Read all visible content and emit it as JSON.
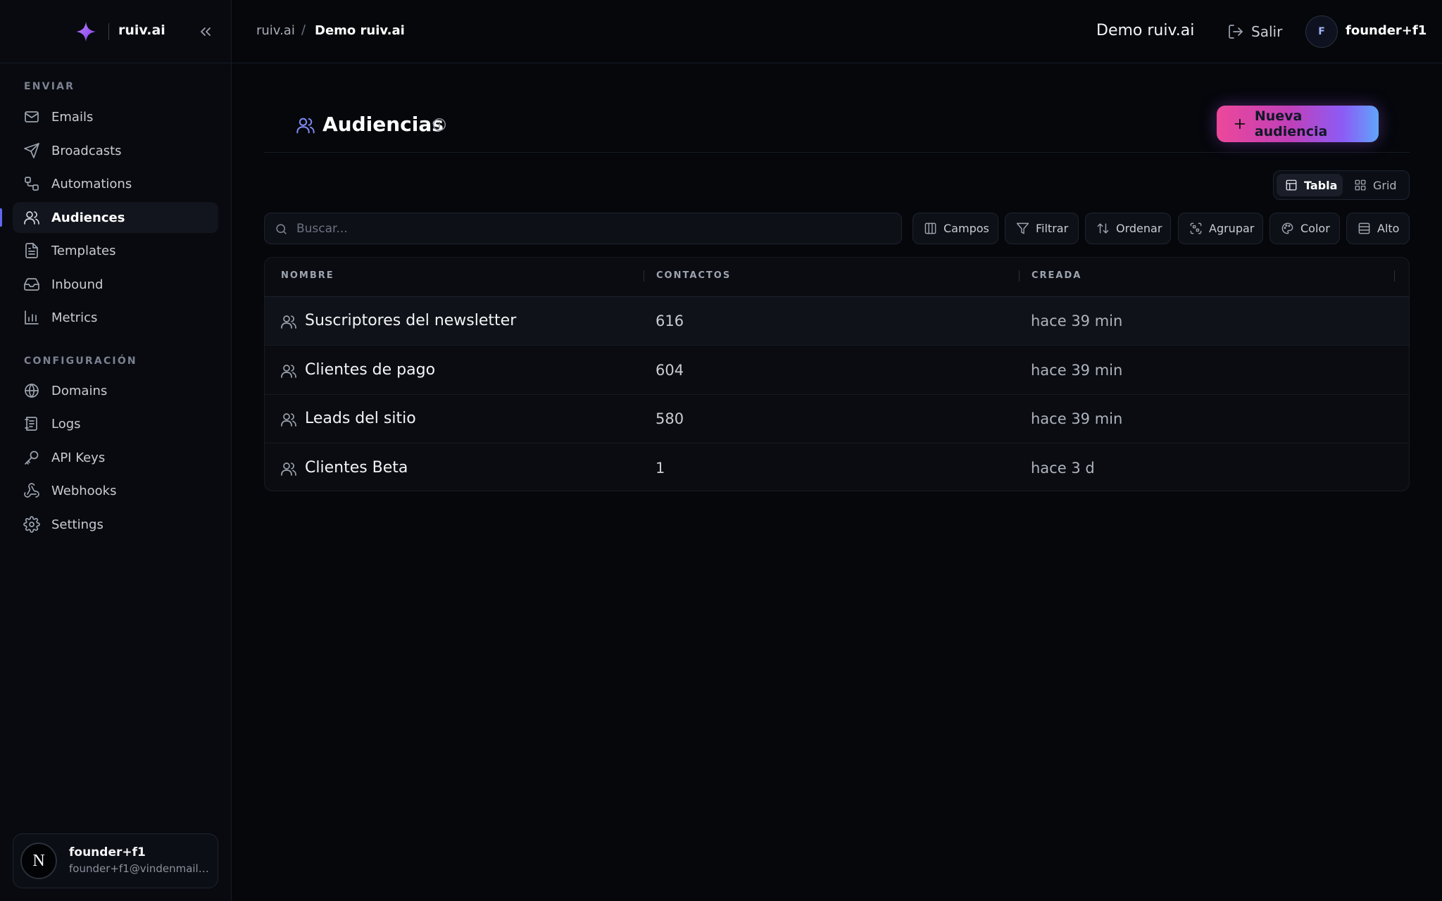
{
  "app": {
    "name": "ruiv.ai"
  },
  "sidebar": {
    "sections": [
      {
        "title": "ENVIAR"
      },
      {
        "title": "CONFIGURACIÓN"
      }
    ],
    "items": [
      {
        "label": "Emails",
        "icon": "mail-icon"
      },
      {
        "label": "Broadcasts",
        "icon": "send-icon"
      },
      {
        "label": "Automations",
        "icon": "workflow-icon"
      },
      {
        "label": "Audiences",
        "icon": "users-icon",
        "active": true
      },
      {
        "label": "Templates",
        "icon": "file-text-icon"
      },
      {
        "label": "Inbound",
        "icon": "inbox-icon"
      },
      {
        "label": "Metrics",
        "icon": "bar-chart-icon"
      },
      {
        "label": "Domains",
        "icon": "globe-icon"
      },
      {
        "label": "Logs",
        "icon": "logs-icon"
      },
      {
        "label": "API Keys",
        "icon": "key-icon"
      },
      {
        "label": "Webhooks",
        "icon": "webhook-icon"
      },
      {
        "label": "Settings",
        "icon": "gear-icon"
      }
    ],
    "user": {
      "avatar": "N",
      "name": "founder+f1",
      "email": "founder+f1@vindenmail.t..."
    }
  },
  "topbar": {
    "breadcrumb": [
      "ruiv.ai",
      "Demo ruiv.ai"
    ],
    "breadcrumb_sep": "/",
    "org_name": "Demo ruiv.ai",
    "logout_label": "Salir",
    "avatar_initial": "F",
    "username": "founder+f1"
  },
  "page": {
    "title": "Audiencias",
    "new_button": "Nueva audiencia",
    "view_toggle": {
      "table": "Tabla",
      "grid": "Grid",
      "selected": "Tabla"
    },
    "search_placeholder": "Buscar...",
    "toolbar": [
      "Campos",
      "Filtrar",
      "Ordenar",
      "Agrupar",
      "Color",
      "Alto"
    ],
    "table": {
      "columns": [
        "NOMBRE",
        "CONTACTOS",
        "CREADA"
      ],
      "rows": [
        {
          "name": "Suscriptores del newsletter",
          "contacts": "616",
          "created": "hace 39 min"
        },
        {
          "name": "Clientes de pago",
          "contacts": "604",
          "created": "hace 39 min"
        },
        {
          "name": "Leads del sitio",
          "contacts": "580",
          "created": "hace 39 min"
        },
        {
          "name": "Clientes Beta",
          "contacts": "1",
          "created": "hace 3 d"
        }
      ]
    }
  },
  "colors": {
    "background": "#05070b",
    "accent": "#6366f1",
    "button_gradient": [
      "#ec4899",
      "#8b5cf6",
      "#60a5fa"
    ]
  }
}
